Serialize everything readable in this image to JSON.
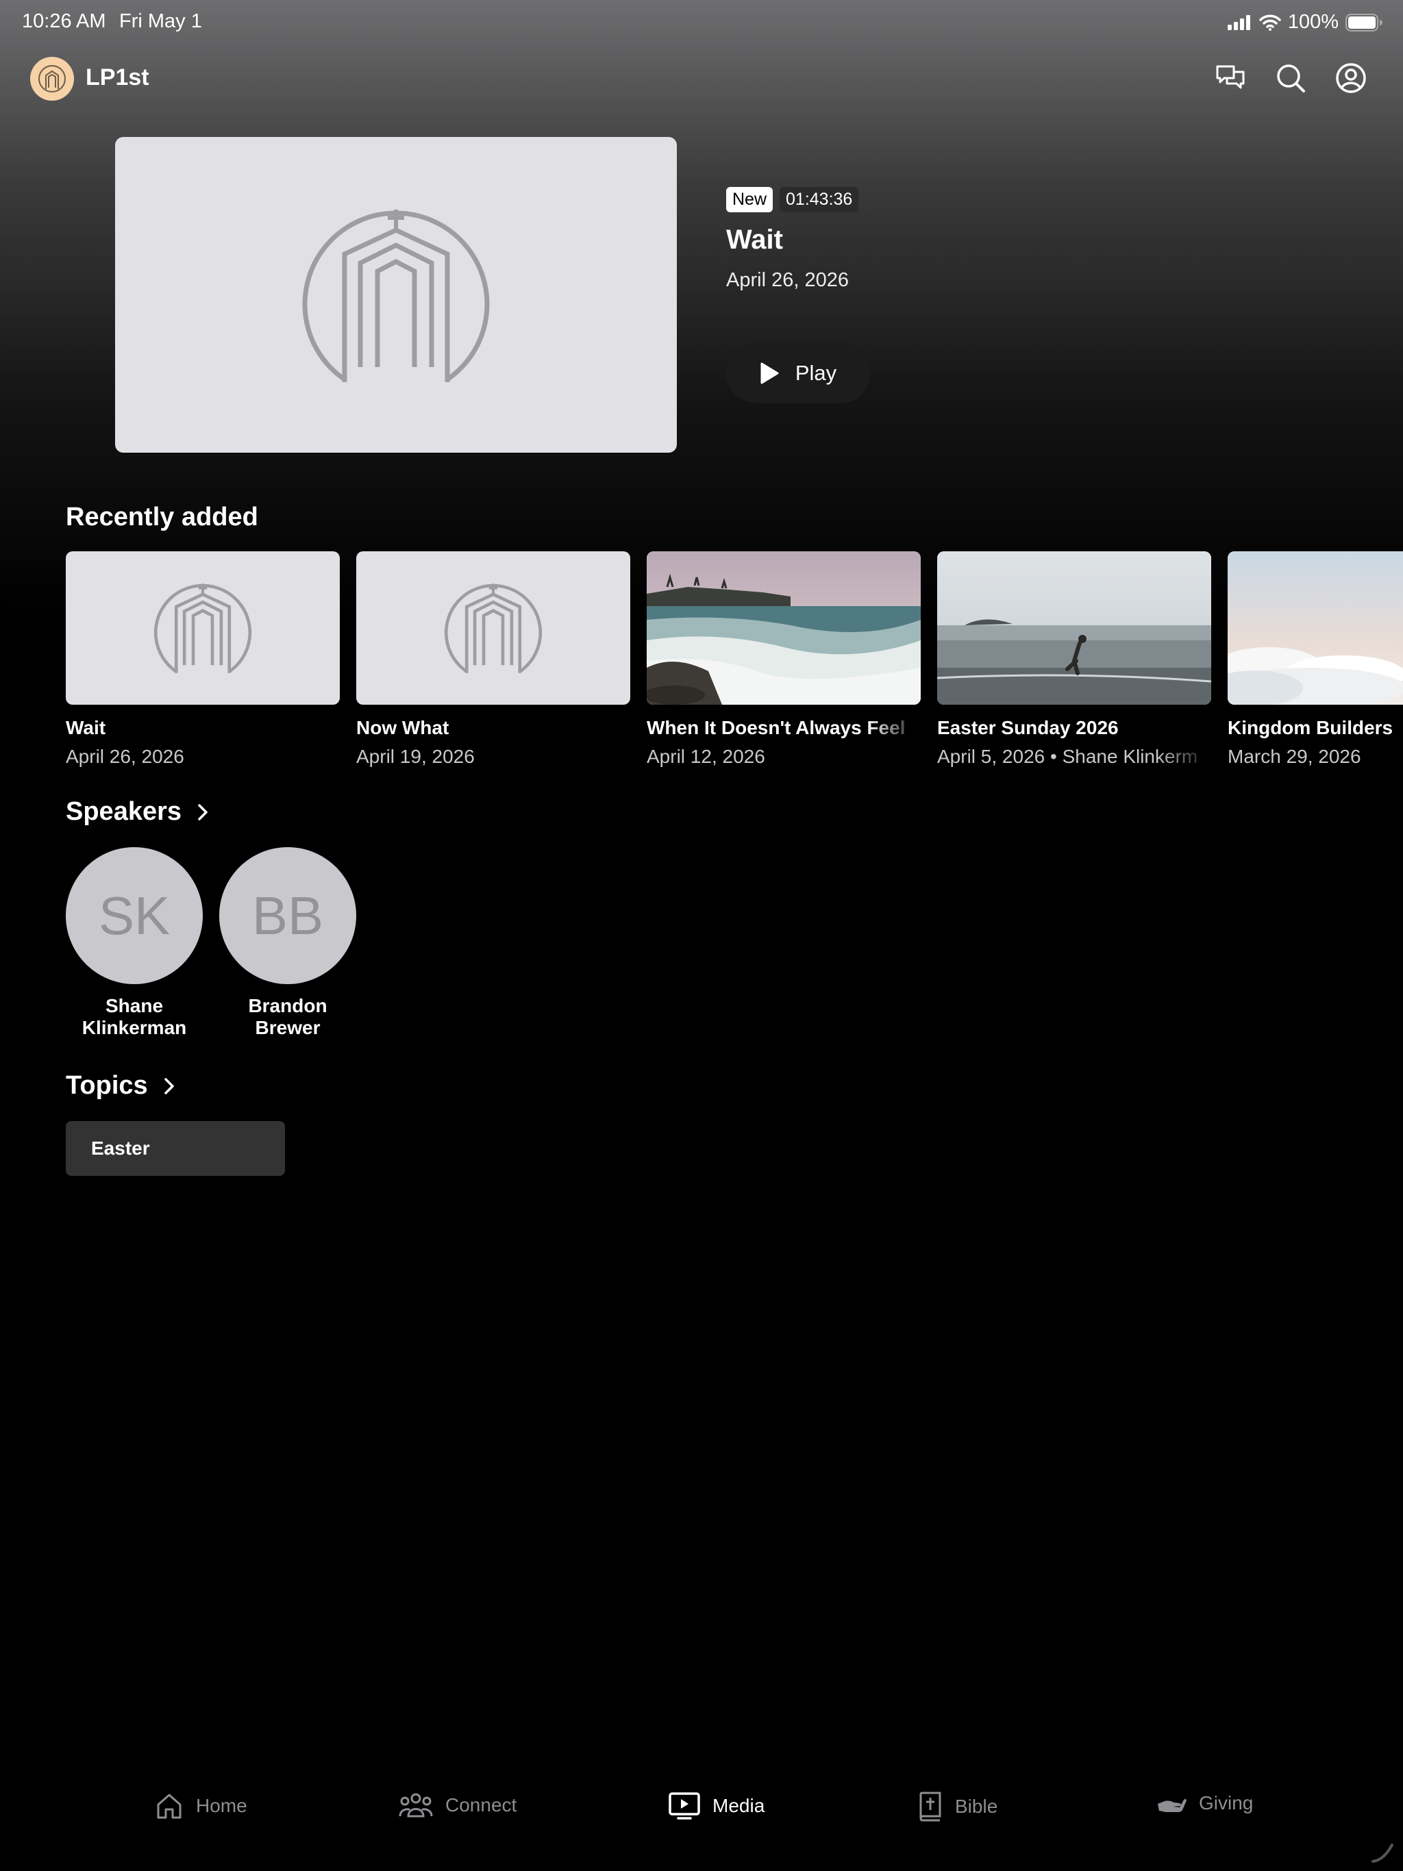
{
  "status_bar": {
    "time": "10:26 AM",
    "date": "Fri May 1",
    "battery": "100%",
    "icons": [
      "signal-icon",
      "wifi-icon",
      "battery-icon"
    ]
  },
  "header": {
    "church_name": "LP1st",
    "icons": [
      "chat-icon",
      "search-icon",
      "profile-icon"
    ]
  },
  "featured": {
    "badge_new": "New",
    "duration": "01:43:36",
    "title": "Wait",
    "date": "April 26, 2026",
    "play_label": "Play"
  },
  "recently_added": {
    "title": "Recently added",
    "items": [
      {
        "title": "Wait",
        "subtitle": "April 26, 2026",
        "thumbnail": "church-logo-placeholder"
      },
      {
        "title": "Now What",
        "subtitle": "April 19, 2026",
        "thumbnail": "church-logo-placeholder"
      },
      {
        "title": "When It Doesn't Always Feel",
        "subtitle": "April 12, 2026",
        "thumbnail": "ocean-waves-photo"
      },
      {
        "title": "Easter Sunday 2026",
        "subtitle": "April 5, 2026 • Shane Klinkerm",
        "thumbnail": "person-in-water-photo"
      },
      {
        "title": "Kingdom Builders",
        "subtitle": "March 29, 2026",
        "thumbnail": "clouds-photo"
      }
    ]
  },
  "speakers": {
    "title": "Speakers",
    "items": [
      {
        "initials": "SK",
        "name_line1": "Shane",
        "name_line2": "Klinkerman"
      },
      {
        "initials": "BB",
        "name_line1": "Brandon",
        "name_line2": "Brewer"
      }
    ]
  },
  "topics": {
    "title": "Topics",
    "items": [
      {
        "label": "Easter"
      }
    ]
  },
  "tabbar": {
    "tabs": [
      {
        "label": "Home",
        "icon": "home-icon"
      },
      {
        "label": "Connect",
        "icon": "people-icon"
      },
      {
        "label": "Media",
        "icon": "tv-play-icon",
        "active": true
      },
      {
        "label": "Bible",
        "icon": "bible-icon"
      },
      {
        "label": "Giving",
        "icon": "giving-hand-icon"
      }
    ]
  },
  "colors": {
    "background": "#000000",
    "placeholder": "#e1e1e5",
    "avatar": "#c8c8cd",
    "logo_bg": "#f6d2a6",
    "inactive_tab": "#8e8e93"
  }
}
